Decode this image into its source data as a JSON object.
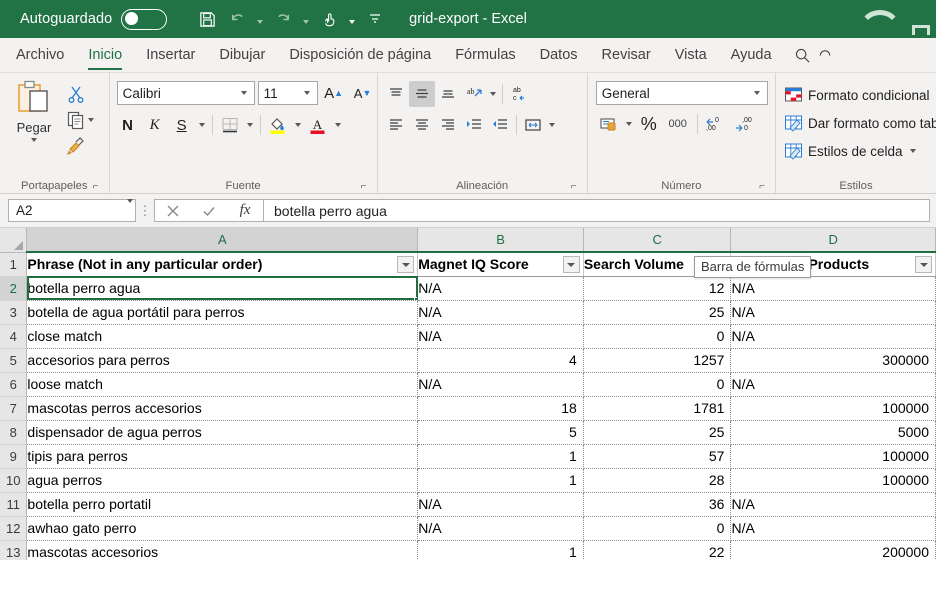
{
  "titlebar": {
    "autosave_label": "Autoguardado",
    "autosave_state": "off",
    "document_title": "grid-export  -  Excel",
    "qat": [
      {
        "name": "save",
        "icon": "save-icon"
      },
      {
        "name": "undo",
        "icon": "undo-icon"
      },
      {
        "name": "redo",
        "icon": "redo-icon"
      },
      {
        "name": "touch-mouse-mode",
        "icon": "touch-mode-icon"
      },
      {
        "name": "customize-qat",
        "icon": "chevron-down-icon"
      }
    ]
  },
  "tabs": [
    {
      "label": "Archivo",
      "active": false
    },
    {
      "label": "Inicio",
      "active": true
    },
    {
      "label": "Insertar",
      "active": false
    },
    {
      "label": "Dibujar",
      "active": false
    },
    {
      "label": "Disposición de página",
      "active": false
    },
    {
      "label": "Fórmulas",
      "active": false
    },
    {
      "label": "Datos",
      "active": false
    },
    {
      "label": "Revisar",
      "active": false
    },
    {
      "label": "Vista",
      "active": false
    },
    {
      "label": "Ayuda",
      "active": false
    }
  ],
  "ribbon": {
    "clipboard": {
      "group_label": "Portapapeles",
      "paste_label": "Pegar",
      "cut_label": "Cortar",
      "copy_label": "Copiar",
      "format_painter_label": "Copiar formato"
    },
    "font": {
      "group_label": "Fuente",
      "font_name": "Calibri",
      "font_size": "11",
      "bold_label": "N",
      "italic_label": "K",
      "underline_label": "S",
      "grow_font_label": "A",
      "shrink_font_label": "A"
    },
    "alignment": {
      "group_label": "Alineación"
    },
    "number": {
      "group_label": "Número",
      "format": "General",
      "percent_label": "%",
      "thousands_label": "000"
    },
    "styles": {
      "group_label": "Estilos",
      "items": [
        "Formato condicional",
        "Dar formato como tabla",
        "Estilos de celda"
      ]
    }
  },
  "formula_bar": {
    "name_box": "A2",
    "cancel_icon": "cancel-icon",
    "enter_icon": "check-icon",
    "function_icon": "fx-icon",
    "value": "botella perro agua",
    "tooltip": "Barra de fórmulas"
  },
  "grid": {
    "columns": [
      "A",
      "B",
      "C",
      "D"
    ],
    "selected_cell": "A2",
    "selected_column": "A",
    "selected_row": 2,
    "headers": [
      "Phrase (Not in any particular order)",
      "Magnet IQ Score",
      "Search Volume",
      "Competing Products"
    ],
    "rows": [
      {
        "n": 2,
        "phrase": "botella perro agua",
        "iq": "N/A",
        "volume": "12",
        "competing": "N/A"
      },
      {
        "n": 3,
        "phrase": "botella de agua portátil para perros",
        "iq": "N/A",
        "volume": "25",
        "competing": "N/A"
      },
      {
        "n": 4,
        "phrase": "close match",
        "iq": "N/A",
        "volume": "0",
        "competing": "N/A"
      },
      {
        "n": 5,
        "phrase": "accesorios para perros",
        "iq": "4",
        "volume": "1257",
        "competing": "300000"
      },
      {
        "n": 6,
        "phrase": "loose match",
        "iq": "N/A",
        "volume": "0",
        "competing": "N/A"
      },
      {
        "n": 7,
        "phrase": "mascotas perros accesorios",
        "iq": "18",
        "volume": "1781",
        "competing": "100000"
      },
      {
        "n": 8,
        "phrase": "dispensador de agua perros",
        "iq": "5",
        "volume": "25",
        "competing": "5000"
      },
      {
        "n": 9,
        "phrase": "tipis para perros",
        "iq": "1",
        "volume": "57",
        "competing": "100000"
      },
      {
        "n": 10,
        "phrase": "agua perros",
        "iq": "1",
        "volume": "28",
        "competing": "100000"
      },
      {
        "n": 11,
        "phrase": "botella perro portatil",
        "iq": "N/A",
        "volume": "36",
        "competing": "N/A"
      },
      {
        "n": 12,
        "phrase": "awhao gato perro",
        "iq": "N/A",
        "volume": "0",
        "competing": "N/A"
      },
      {
        "n": 13,
        "phrase": "mascotas accesorios",
        "iq": "1",
        "volume": "22",
        "competing": "200000"
      }
    ]
  },
  "colors": {
    "excel_green": "#217346",
    "header_green": "#1d6f42",
    "ribbon_bg": "#f3f2f1"
  }
}
